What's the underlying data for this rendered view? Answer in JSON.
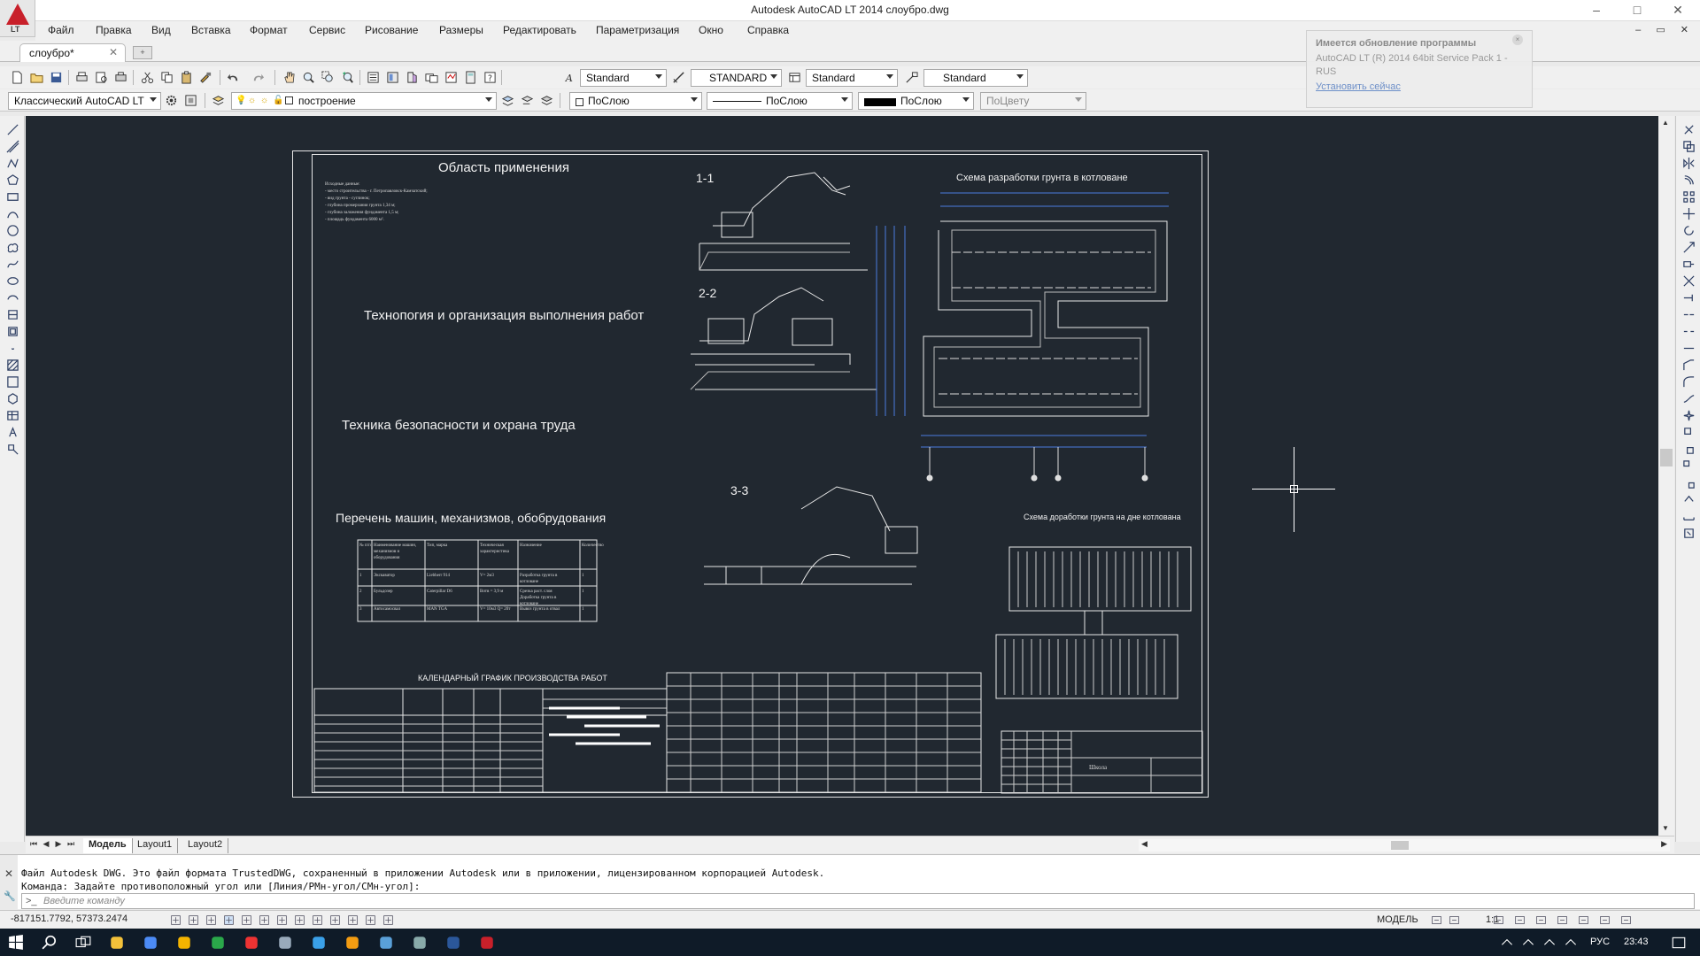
{
  "window": {
    "title": "Autodesk AutoCAD LT 2014    слоубро.dwg",
    "logo_badge": "LT",
    "controls": {
      "minimize": "–",
      "maximize": "□",
      "close": "✕"
    }
  },
  "menu": {
    "items": [
      "Файл",
      "Правка",
      "Вид",
      "Вставка",
      "Формат",
      "Сервис",
      "Рисование",
      "Размеры",
      "Редактировать",
      "Параметризация",
      "Окно",
      "Справка"
    ],
    "mdi_controls": "– ▭ ✕"
  },
  "document_tab": {
    "label": "слоубро*",
    "close": "✕",
    "new_tab": "+"
  },
  "toolbar1": {
    "text_style": "Standard",
    "dim_style": "STANDARD",
    "table_style": "Standard",
    "multileader_style": "Standard"
  },
  "toolbar2": {
    "workspace": "Классический AutoCAD LT",
    "layer": "построение",
    "color": "ПоСлою",
    "linetype": "ПоСлою",
    "lineweight": "ПоСлою",
    "plotstyle": "ПоЦвету"
  },
  "notification": {
    "title": "Имеется обновление программы",
    "body": "AutoCAD LT (R) 2014 64bit Service Pack 1 - RUS",
    "link": "Установить сейчас",
    "close": "×"
  },
  "drawing": {
    "heading_scope": "Область применения",
    "heading_tech": "Технопогия и организация выполнения работ",
    "heading_safety": "Техника безопасности и охрана труда",
    "heading_machines": "Перечень машин, механизмов, обобрудования",
    "heading_schedule": "КАЛЕНДАРНЫЙ ГРАФИК ПРОИЗВОДСТВА РАБОТ",
    "heading_scheme_pit": "Схема разработки грунта в котловане",
    "heading_scheme_bottom": "Схема доработки грунта на дне котлована",
    "section_1": "1-1",
    "section_2": "2-2",
    "section_3": "3-3",
    "scope_lines": [
      "Исходные данные:",
      "- место строительства - г. Петропавловск-Камчатский;",
      "- вид грунта - суглинок;",
      "- глубина промерзания грунта 1,34 м;",
      "- глубина заложения фундамента 1,5 м;",
      "- площадь фундамента 6000 м²."
    ],
    "machines_table": {
      "headers": [
        "№ п/п",
        "Наименование машин, механизмов и оборудования",
        "Тип, марка",
        "Техническая характеристика",
        "Назначение",
        "Количество"
      ],
      "rows": [
        [
          "1",
          "Экскаватор",
          "Liebherr 914",
          "V= 2м3",
          "Разработка грунта в котловане",
          "1"
        ],
        [
          "2",
          "Бульдозер",
          "Caterpillar D6",
          "Bотв = 3,9 м",
          "Срезка раст. слоя Доработка грунта в котловане",
          "1"
        ],
        [
          "3",
          "Автосамосвал",
          "MAN TGA",
          "V= 10м3 Q= 20т",
          "Вывоз грунта в отвал",
          "1"
        ]
      ]
    },
    "stamp_text": "Школа"
  },
  "layout_tabs": [
    "Модель",
    "Layout1",
    "Layout2"
  ],
  "command": {
    "history": [
      "Файл Autodesk DWG. Это файл формата TrustedDWG, сохраненный в приложении Autodesk или в приложении, лицензированном корпорацией Autodesk.",
      "Команда: Задайте противоположный угол или [Линия/РМн-угол/СМн-угол]:"
    ],
    "placeholder": "Введите команду"
  },
  "status": {
    "coords": "-817151.7792, 57373.2474",
    "space": "МОДЕЛЬ",
    "scale": "1:1"
  },
  "taskbar": {
    "lang": "РУС",
    "time": "23:43"
  },
  "colors": {
    "canvas": "#212830",
    "accent_red": "#c8202a",
    "taskbar": "#0f1b28"
  }
}
